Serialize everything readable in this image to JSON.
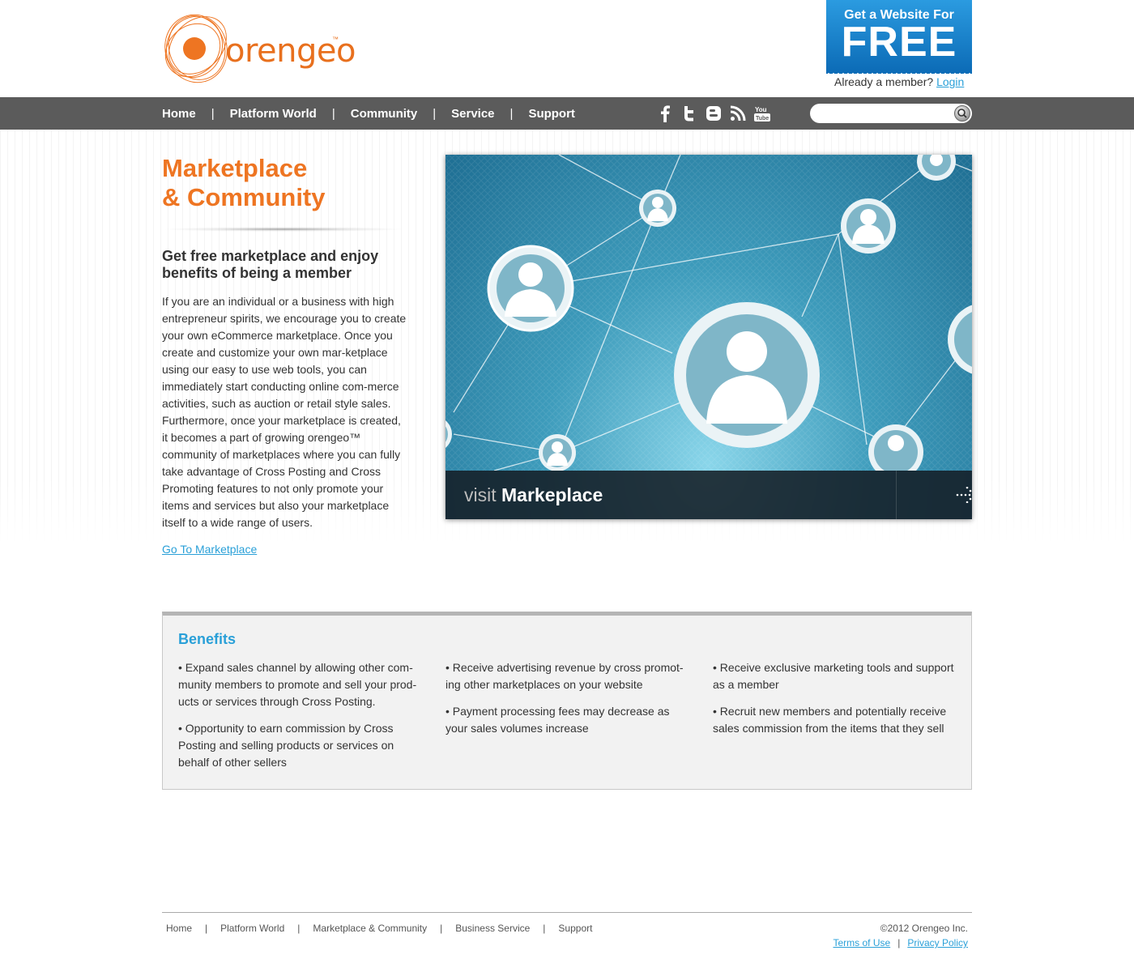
{
  "brand": {
    "logo_text": "orengeo",
    "trademark": "™",
    "accent_color": "#ee7522",
    "link_color": "#2aa0d8"
  },
  "promo": {
    "line1": "Get a Website For",
    "line2": "FREE",
    "member_prompt": "Already a member?",
    "login_label": "Login"
  },
  "nav": {
    "items": [
      "Home",
      "Platform World",
      "Community",
      "Service",
      "Support"
    ],
    "separator": "|"
  },
  "social": {
    "icons": [
      "facebook-icon",
      "twitter-icon",
      "blogger-icon",
      "rss-icon",
      "youtube-icon"
    ],
    "youtube_label": "You Tube"
  },
  "search": {
    "placeholder": ""
  },
  "main": {
    "title_line1": "Marketplace",
    "title_line2": "& Community",
    "subtitle": "Get free marketplace and enjoy benefits of being a member",
    "body": "If you are an individual or a business with high entrepreneur spirits, we encourage you to create your own eCommerce marketplace. Once you create and customize your own mar-ketplace using our easy to use web tools, you can immediately start conducting online com-merce activities, such as auction or retail style sales. Furthermore, once your marketplace is created, it becomes a part of growing orengeo™ community of marketplaces where you can fully take advantage of Cross Posting and Cross Promoting features to not only promote your items and services but also your marketplace itself to a wide range of users.",
    "link_label": "Go To Marketplace"
  },
  "hero": {
    "visit_word": "visit",
    "target_word": "Markeplace",
    "arrow": "⇢"
  },
  "benefits": {
    "heading": "Benefits",
    "columns": [
      [
        "• Expand sales channel by allowing other com-munity members to promote and sell your prod-ucts or services through Cross Posting.",
        "• Opportunity to earn commission by Cross Posting and selling products or services on behalf of other sellers"
      ],
      [
        "• Receive advertising revenue by cross promot-ing other marketplaces on your website",
        "• Payment processing fees may decrease as your sales volumes increase"
      ],
      [
        "• Receive exclusive marketing tools and support as a member",
        "• Recruit new members and potentially receive sales commission from the items that they sell"
      ]
    ]
  },
  "footer": {
    "links": [
      "Home",
      "Platform World",
      "Marketplace & Community",
      "Business Service",
      "Support"
    ],
    "separator": "|",
    "copyright": "©2012 Orengeo Inc.",
    "terms_label": "Terms of Use",
    "privacy_label": "Privacy Policy"
  }
}
